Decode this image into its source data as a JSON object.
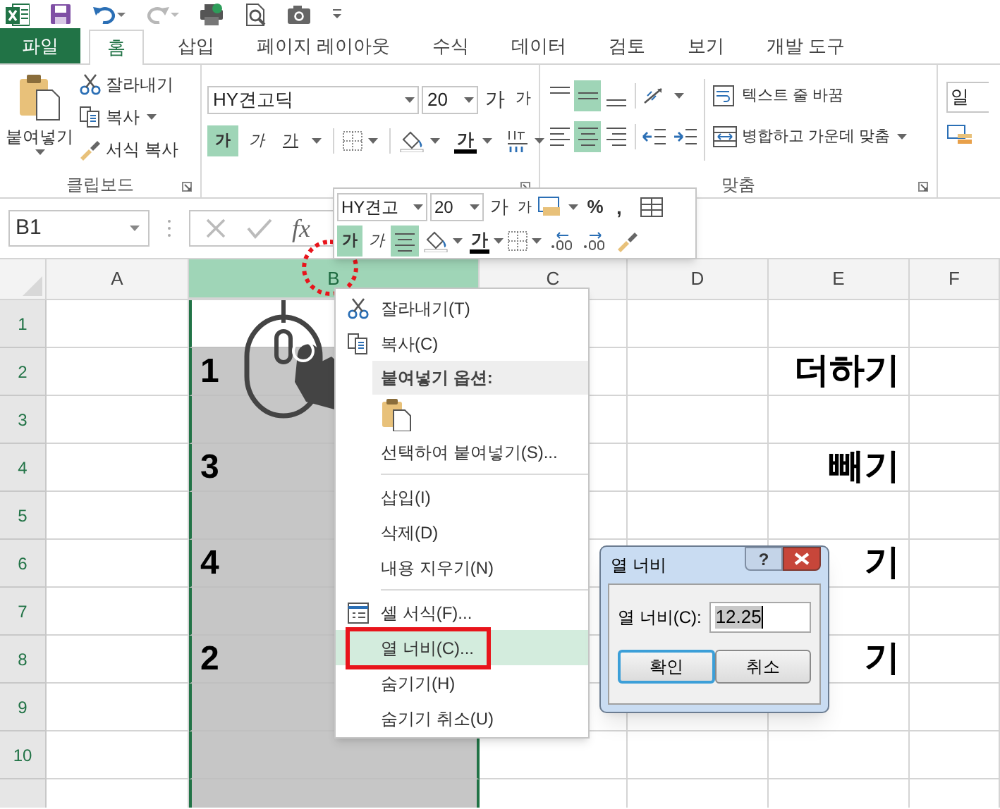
{
  "quick_access_toolbar": {
    "redo_enabled": false
  },
  "tabs": [
    {
      "label": "파일",
      "kind": "file",
      "selected": false
    },
    {
      "label": "홈",
      "kind": "tab",
      "selected": true
    },
    {
      "label": "삽입",
      "kind": "tab",
      "selected": false
    },
    {
      "label": "페이지 레이아웃",
      "kind": "tab",
      "selected": false
    },
    {
      "label": "수식",
      "kind": "tab",
      "selected": false
    },
    {
      "label": "데이터",
      "kind": "tab",
      "selected": false
    },
    {
      "label": "검토",
      "kind": "tab",
      "selected": false
    },
    {
      "label": "보기",
      "kind": "tab",
      "selected": false
    },
    {
      "label": "개발 도구",
      "kind": "tab",
      "selected": false
    }
  ],
  "ribbon": {
    "clipboard": {
      "paste": "붙여넣기",
      "cut": "잘라내기",
      "copy": "복사",
      "format_painter": "서식 복사",
      "label": "클립보드"
    },
    "font": {
      "font_name": "HY견고딕",
      "font_size": "20",
      "grow": "가",
      "shrink": "가",
      "styles": [
        {
          "label": "가",
          "kind": "bold",
          "selected": true
        },
        {
          "label": "가",
          "kind": "italic",
          "selected": false
        },
        {
          "label": "가",
          "kind": "underline",
          "selected": false
        }
      ],
      "font_color": "가"
    },
    "alignment": {
      "vertical": [
        {
          "selected": false
        },
        {
          "selected": true
        },
        {
          "selected": false
        }
      ],
      "horizontal": [
        {
          "selected": false
        },
        {
          "selected": true
        },
        {
          "selected": false
        }
      ],
      "wrap_text": "텍스트 줄 바꿈",
      "merge_center": "병합하고 가운데 맞춤",
      "label": "맞춤"
    },
    "number": {
      "format": "일"
    }
  },
  "formula_bar": {
    "name_box": "B1",
    "function_label": "fx"
  },
  "grid": {
    "columns": [
      {
        "label": "A",
        "selected": false,
        "annotated": false
      },
      {
        "label": "B",
        "selected": true,
        "annotated": true
      },
      {
        "label": "C",
        "selected": false,
        "annotated": false
      },
      {
        "label": "D",
        "selected": false,
        "annotated": false
      },
      {
        "label": "E",
        "selected": false,
        "annotated": false
      },
      {
        "label": "F",
        "selected": false,
        "annotated": false
      }
    ],
    "rows": [
      {
        "label": "1"
      },
      {
        "label": "2",
        "column_b": "1",
        "column_e": "더하기"
      },
      {
        "label": "3"
      },
      {
        "label": "4",
        "column_b": "3",
        "column_e": "빼기"
      },
      {
        "label": "5"
      },
      {
        "label": "6",
        "column_b": "4",
        "column_e": "기"
      },
      {
        "label": "7"
      },
      {
        "label": "8",
        "column_b": "2",
        "column_e": "기"
      },
      {
        "label": "9"
      },
      {
        "label": "10"
      }
    ]
  },
  "mini_toolbar": {
    "font_name": "HY견고",
    "font_size": "20",
    "grow": "가",
    "shrink": "가",
    "percent": "%",
    "comma": ",",
    "styles": [
      {
        "label": "가",
        "kind": "bold",
        "selected": true
      },
      {
        "label": "가",
        "kind": "italic",
        "selected": false
      }
    ],
    "center_align_selected": true,
    "font_color": "가"
  },
  "context_menu": [
    {
      "kind": "item",
      "label": "잘라내기(T)",
      "selected": false,
      "annotated": false
    },
    {
      "kind": "item",
      "label": "복사(C)",
      "selected": false,
      "annotated": false
    },
    {
      "kind": "header",
      "label": "붙여넣기 옵션:"
    },
    {
      "kind": "paste_option"
    },
    {
      "kind": "item",
      "label": "선택하여 붙여넣기(S)...",
      "selected": false,
      "annotated": false
    },
    {
      "kind": "separator"
    },
    {
      "kind": "item",
      "label": "삽입(I)",
      "selected": false,
      "annotated": false
    },
    {
      "kind": "item",
      "label": "삭제(D)",
      "selected": false,
      "annotated": false
    },
    {
      "kind": "item",
      "label": "내용 지우기(N)",
      "selected": false,
      "annotated": false
    },
    {
      "kind": "separator"
    },
    {
      "kind": "item",
      "label": "셀 서식(F)...",
      "selected": false,
      "annotated": false
    },
    {
      "kind": "item",
      "label": "열 너비(C)...",
      "selected": true,
      "annotated": true
    },
    {
      "kind": "item",
      "label": "숨기기(H)",
      "selected": false,
      "annotated": false
    },
    {
      "kind": "item",
      "label": "숨기기 취소(U)",
      "selected": false,
      "annotated": false
    }
  ],
  "dialog": {
    "title": "열 너비",
    "help": "?",
    "label": "열 너비(C):",
    "value": "12.25",
    "buttons": [
      {
        "label": "확인",
        "focused": true
      },
      {
        "label": "취소",
        "focused": false
      }
    ]
  }
}
